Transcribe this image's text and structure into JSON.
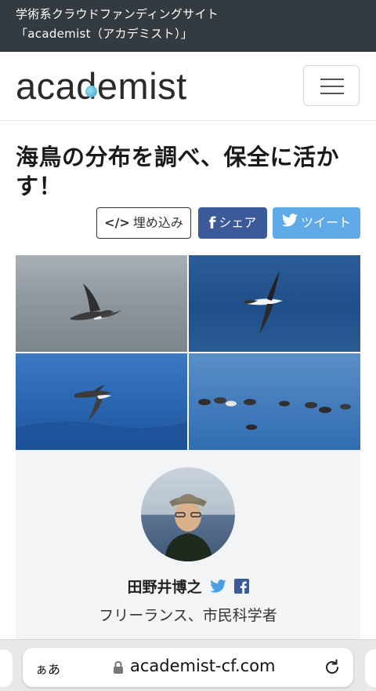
{
  "banner": {
    "line1": "学術系クラウドファンディングサイト",
    "line2": "「academist（アカデミスト）」"
  },
  "navbar": {
    "logo": "academist",
    "menu_icon": "hamburger-menu-icon"
  },
  "article": {
    "title": "海鳥の分布を調べ、保全に活かす！"
  },
  "share": {
    "embed_label": "埋め込み",
    "embed_icon": "code-icon",
    "facebook_label": "シェア",
    "facebook_icon": "facebook-icon",
    "twitter_label": "ツイート",
    "twitter_icon": "twitter-icon",
    "facebook_color": "#3b5a99",
    "twitter_color": "#5ea9e6"
  },
  "photos": [
    {
      "subject": "seabird flying over grey sea"
    },
    {
      "subject": "seabird flying over blue sea"
    },
    {
      "subject": "seabird gliding over waves"
    },
    {
      "subject": "flock of seabirds on water"
    }
  ],
  "profile": {
    "name": "田野井博之",
    "role": "フリーランス、市民科学者",
    "twitter_icon": "twitter-icon",
    "facebook_icon": "facebook-icon"
  },
  "browser": {
    "aa_label": "ぁあ",
    "url": "academist-cf.com",
    "lock_icon": "lock-icon",
    "reload_icon": "reload-icon"
  }
}
